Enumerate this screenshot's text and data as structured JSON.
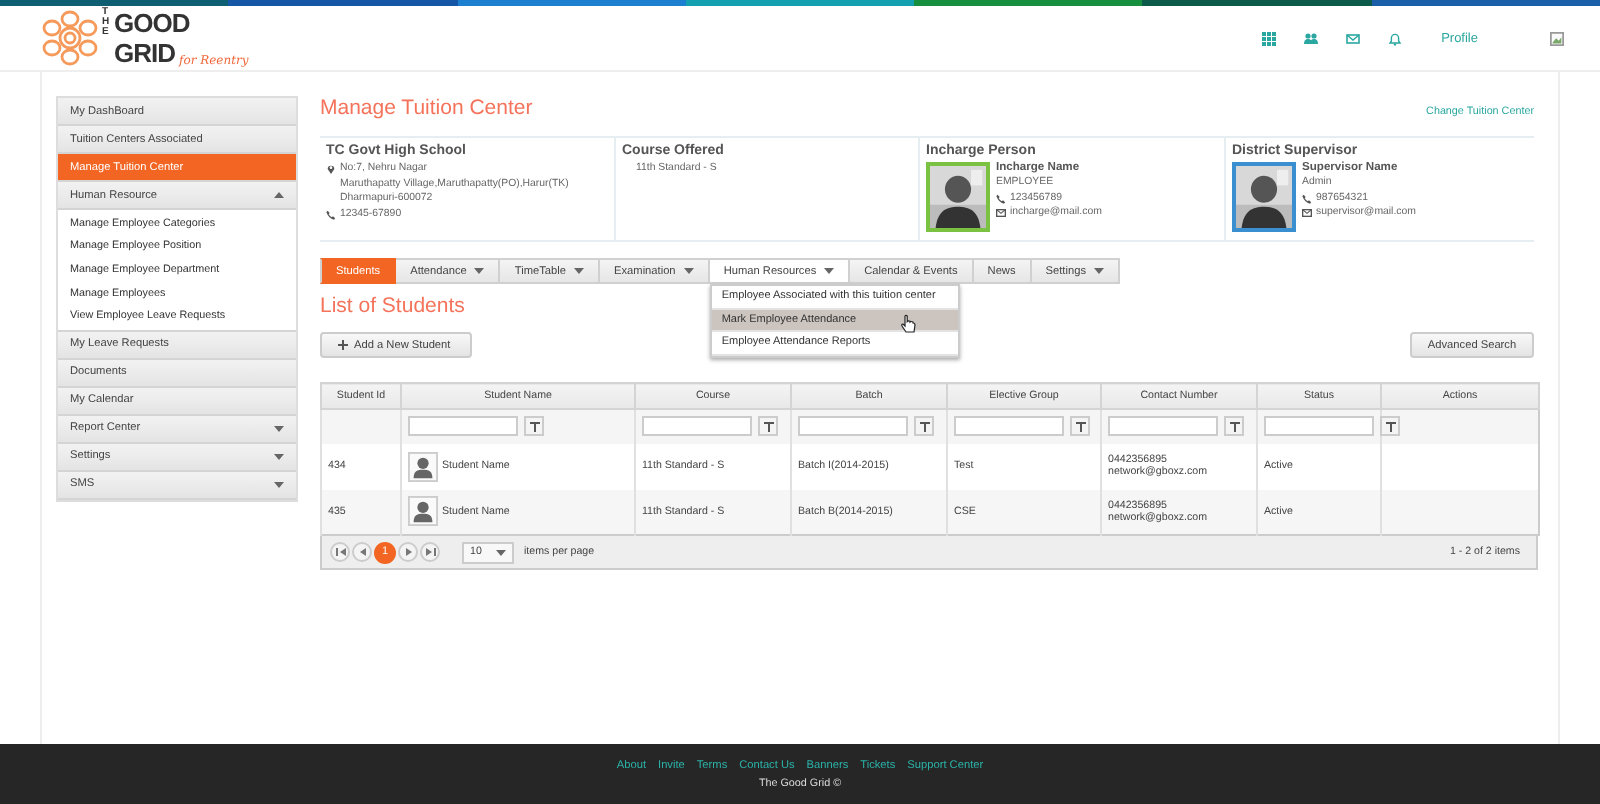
{
  "logo": {
    "line_1": "THE",
    "line_2": "GOOD",
    "line_3": "GRID",
    "tagline": "for Reentry"
  },
  "top_nav": {
    "profile_link": "Profile"
  },
  "sidebar": {
    "items": [
      {
        "kind": "link",
        "label": "My DashBoard",
        "selected": false
      },
      {
        "kind": "link",
        "label": "Tuition Centers Associated",
        "selected": false
      },
      {
        "kind": "link",
        "label": "Manage Tuition Center",
        "selected": true
      },
      {
        "kind": "group",
        "label": "Human Resource",
        "selected": false,
        "expanded": true,
        "children": [
          {
            "label": "Manage Employee Categories",
            "selected": false
          },
          {
            "label": "Manage Employee Position",
            "selected": false
          },
          {
            "label": "Manage Employee Department",
            "selected": false
          },
          {
            "label": "Manage Employees",
            "selected": false
          },
          {
            "label": "View Employee Leave Requests",
            "selected": false
          }
        ]
      },
      {
        "kind": "link",
        "label": "My Leave Requests",
        "selected": false
      },
      {
        "kind": "link",
        "label": "Documents",
        "selected": false
      },
      {
        "kind": "link",
        "label": "My Calendar",
        "selected": false
      },
      {
        "kind": "group",
        "label": "Report Center",
        "selected": false,
        "expanded": false
      },
      {
        "kind": "group",
        "label": "Settings",
        "selected": false,
        "expanded": false
      },
      {
        "kind": "group",
        "label": "SMS",
        "selected": false,
        "expanded": false
      }
    ]
  },
  "page": {
    "title": "Manage Tuition Center",
    "change_link": "Change Tuition Center"
  },
  "info_cards": [
    {
      "kind": "school",
      "title": "TC Govt High School",
      "address_lines": [
        "No:7, Nehru Nagar",
        "Maruthapatty Village,Maruthapatty(PO),Harur(TK)",
        "Dharmapuri-600072"
      ],
      "phone": "12345-67890"
    },
    {
      "kind": "course",
      "title": "Course Offered",
      "text": "11th Standard - S"
    },
    {
      "kind": "person",
      "title": "Incharge Person",
      "name": "Incharge Name",
      "role": "EMPLOYEE",
      "phone": "123456789",
      "email": "incharge@mail.com",
      "color": "#7cc242"
    },
    {
      "kind": "person",
      "title": "District Supervisor",
      "name": "Supervisor Name",
      "role": "Admin",
      "phone": "987654321",
      "email": "supervisor@mail.com",
      "color": "#3a8fd0"
    }
  ],
  "tabs": [
    {
      "label": "Students",
      "selected": true,
      "has_menu": false,
      "expanded": false
    },
    {
      "label": "Attendance",
      "selected": false,
      "has_menu": true,
      "expanded": false
    },
    {
      "label": "TimeTable",
      "selected": false,
      "has_menu": true,
      "expanded": false
    },
    {
      "label": "Examination",
      "selected": false,
      "has_menu": true,
      "expanded": false
    },
    {
      "label": "Human Resources",
      "selected": false,
      "has_menu": true,
      "expanded": true,
      "menu": [
        {
          "label": "Employee Associated with this tuition center",
          "highlighted": false
        },
        {
          "label": "Mark Employee Attendance",
          "highlighted": true
        },
        {
          "label": "Employee Attendance Reports",
          "highlighted": false
        }
      ]
    },
    {
      "label": "Calendar & Events",
      "selected": false,
      "has_menu": false,
      "expanded": false
    },
    {
      "label": "News",
      "selected": false,
      "has_menu": false,
      "expanded": false
    },
    {
      "label": "Settings",
      "selected": false,
      "has_menu": true,
      "expanded": false
    }
  ],
  "list": {
    "title": "List of Students",
    "add_button": "Add a New Student",
    "search_button": "Advanced Search"
  },
  "table": {
    "columns": [
      {
        "label": "Student Id",
        "filter": false
      },
      {
        "label": "Student Name",
        "filter": true
      },
      {
        "label": "Course",
        "filter": true
      },
      {
        "label": "Batch",
        "filter": true
      },
      {
        "label": "Elective Group",
        "filter": true
      },
      {
        "label": "Contact Number",
        "filter": true
      },
      {
        "label": "Status",
        "filter": true
      },
      {
        "label": "Actions",
        "filter": false
      }
    ],
    "rows": [
      {
        "id": "434",
        "name": "Student Name",
        "course": "11th Standard - S",
        "batch": "Batch I(2014-2015)",
        "elective": "Test",
        "phone": "0442356895",
        "email": "network@gboxz.com",
        "status": "Active"
      },
      {
        "id": "435",
        "name": "Student Name",
        "course": "11th Standard - S",
        "batch": "Batch B(2014-2015)",
        "elective": "CSE",
        "phone": "0442356895",
        "email": "network@gboxz.com",
        "status": "Active"
      }
    ],
    "pager": {
      "current_page": "1",
      "page_size": "10",
      "page_size_label": "items per page",
      "summary": "1 - 2 of 2 items"
    }
  },
  "footer": {
    "links": [
      "About",
      "Invite",
      "Terms",
      "Contact Us",
      "Banners",
      "Tickets",
      "Support Center"
    ],
    "copyright": "The Good Grid ©"
  }
}
